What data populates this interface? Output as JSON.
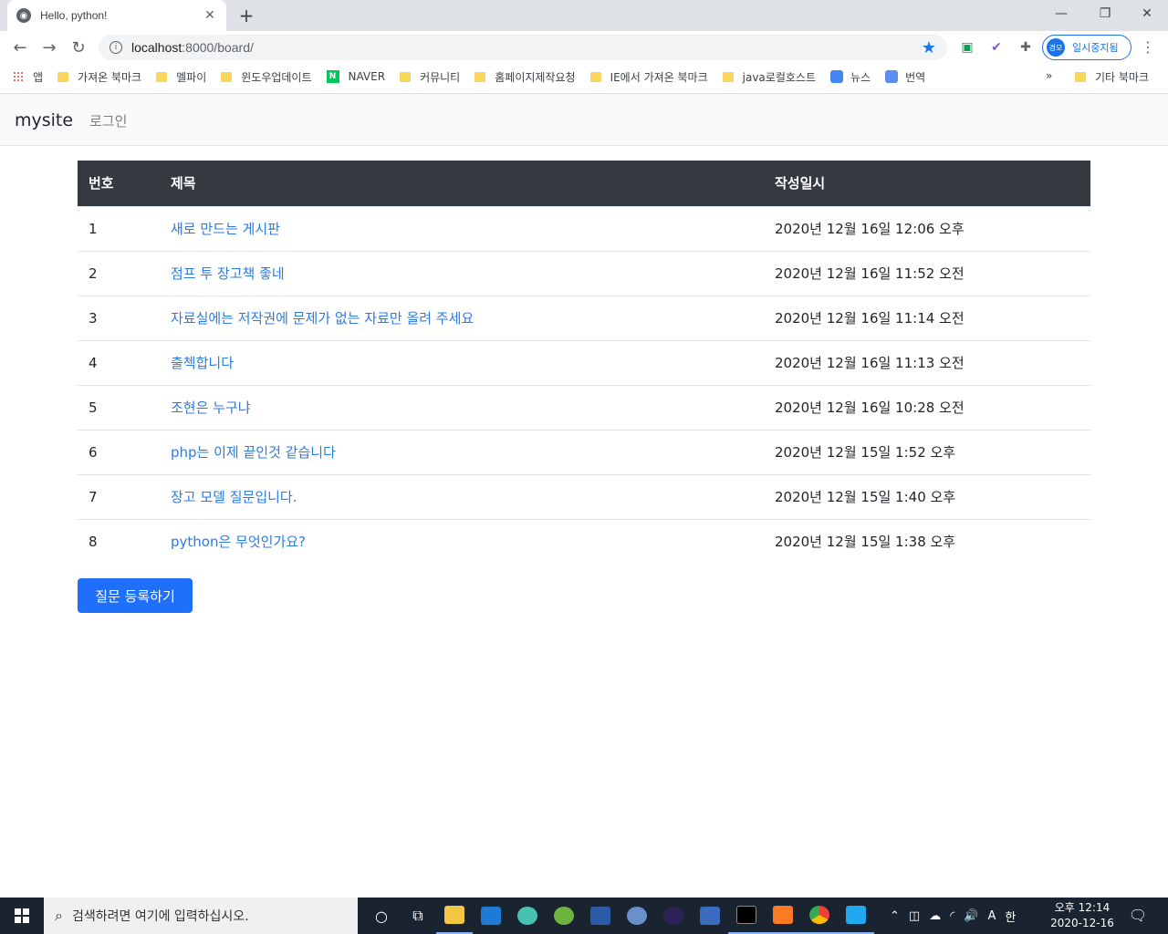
{
  "browser": {
    "tab_title": "Hello, python!",
    "tab_close": "✕",
    "new_tab": "+",
    "url_host": "localhost",
    "url_rest": ":8000/board/",
    "profile_initials": "경모",
    "profile_label": "일시중지됨",
    "bookmarks": [
      {
        "label": "앱",
        "kind": "apps"
      },
      {
        "label": "가져온 북마크",
        "kind": "folder"
      },
      {
        "label": "멜파이",
        "kind": "folder"
      },
      {
        "label": "윈도우업데이트",
        "kind": "folder"
      },
      {
        "label": "NAVER",
        "kind": "naver"
      },
      {
        "label": "커뮤니티",
        "kind": "folder"
      },
      {
        "label": "홈페이지제작요청",
        "kind": "folder"
      },
      {
        "label": "IE에서 가져온 북마크",
        "kind": "folder"
      },
      {
        "label": "java로컬호스트",
        "kind": "folder"
      },
      {
        "label": "뉴스",
        "kind": "news"
      },
      {
        "label": "번역",
        "kind": "translate"
      }
    ],
    "bookmarks_more": "»",
    "other_bookmarks": "기타 북마크"
  },
  "page": {
    "brand": "mysite",
    "login_link": "로그인",
    "table": {
      "headers": [
        "번호",
        "제목",
        "작성일시"
      ],
      "rows": [
        {
          "num": "1",
          "subject": "새로 만드는 게시판",
          "date": "2020년 12월 16일 12:06 오후"
        },
        {
          "num": "2",
          "subject": "점프 투 장고책 좋네",
          "date": "2020년 12월 16일 11:52 오전"
        },
        {
          "num": "3",
          "subject": "자료실에는 저작권에 문제가 없는 자료만 올려 주세요",
          "date": "2020년 12월 16일 11:14 오전"
        },
        {
          "num": "4",
          "subject": "출첵합니다",
          "date": "2020년 12월 16일 11:13 오전"
        },
        {
          "num": "5",
          "subject": "조현은 누구냐",
          "date": "2020년 12월 16일 10:28 오전"
        },
        {
          "num": "6",
          "subject": "php는 이제 끝인것 같습니다",
          "date": "2020년 12월 15일 1:52 오후"
        },
        {
          "num": "7",
          "subject": "장고 모델 질문입니다.",
          "date": "2020년 12월 15일 1:40 오후"
        },
        {
          "num": "8",
          "subject": "python은 무엇인가요?",
          "date": "2020년 12월 15일 1:38 오후"
        }
      ]
    },
    "create_button": "질문 등록하기"
  },
  "taskbar": {
    "search_placeholder": "검색하려면 여기에 입력하십시오.",
    "ime_a": "A",
    "ime_han": "한",
    "clock_time": "오후 12:14",
    "clock_date": "2020-12-16"
  }
}
